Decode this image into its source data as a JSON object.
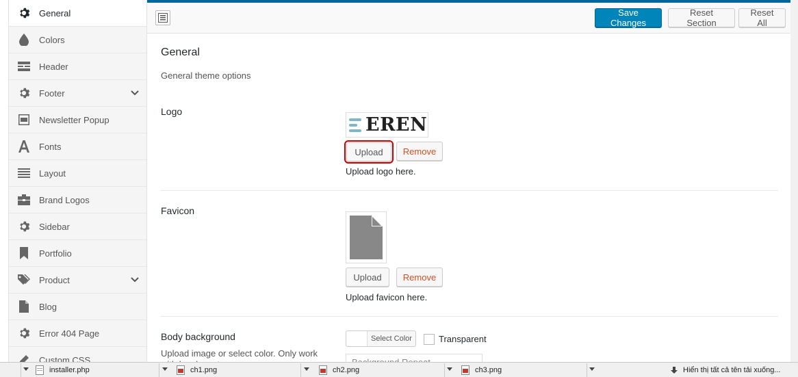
{
  "sidebar": {
    "items": [
      {
        "label": "General",
        "icon": "gear-icon",
        "active": true
      },
      {
        "label": "Colors",
        "icon": "drop-icon"
      },
      {
        "label": "Header",
        "icon": "header-icon"
      },
      {
        "label": "Footer",
        "icon": "gear-icon",
        "has_children": true
      },
      {
        "label": "Newsletter Popup",
        "icon": "window-icon"
      },
      {
        "label": "Fonts",
        "icon": "font-icon"
      },
      {
        "label": "Layout",
        "icon": "list-icon"
      },
      {
        "label": "Brand Logos",
        "icon": "briefcase-icon"
      },
      {
        "label": "Sidebar",
        "icon": "gear-icon"
      },
      {
        "label": "Portfolio",
        "icon": "bookmark-icon"
      },
      {
        "label": "Product",
        "icon": "tag-icon",
        "has_children": true
      },
      {
        "label": "Blog",
        "icon": "document-icon"
      },
      {
        "label": "Error 404 Page",
        "icon": "gear-icon"
      },
      {
        "label": "Custom CSS",
        "icon": "pencil-icon"
      }
    ]
  },
  "toolbar": {
    "save_label": "Save Changes",
    "reset_section_label": "Reset Section",
    "reset_all_label": "Reset All"
  },
  "section": {
    "title": "General",
    "description": "General theme options"
  },
  "logo": {
    "label": "Logo",
    "preview_text": "EREN",
    "upload_label": "Upload",
    "remove_label": "Remove",
    "help": "Upload logo here."
  },
  "favicon": {
    "label": "Favicon",
    "upload_label": "Upload",
    "remove_label": "Remove",
    "help": "Upload favicon here."
  },
  "body_background": {
    "label": "Body background",
    "description": "Upload image or select color. Only work with box layout",
    "select_color_label": "Select Color",
    "transparent_label": "Transparent",
    "repeat_placeholder": "Background Repeat"
  },
  "taskbar": {
    "files": [
      "installer.php",
      "ch1.png",
      "ch2.png",
      "ch3.png"
    ],
    "right_text": "Hiển thị tất cả tên tải xuống..."
  },
  "colors": {
    "accent": "#0085ba",
    "topbar_border": "#00669b",
    "remove_text": "#d54e21",
    "highlight": "#cc0000"
  }
}
